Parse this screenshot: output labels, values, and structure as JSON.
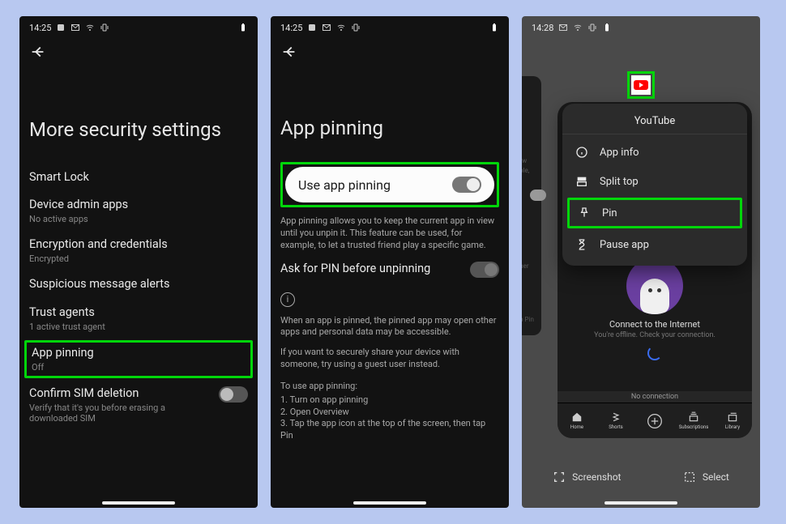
{
  "statusbar": {
    "time1": "14:25",
    "time3": "14:28"
  },
  "screen1": {
    "title": "More security settings",
    "items": [
      {
        "title": "Smart Lock",
        "sub": ""
      },
      {
        "title": "Device admin apps",
        "sub": "No active apps"
      },
      {
        "title": "Encryption and credentials",
        "sub": "Encrypted"
      },
      {
        "title": "Suspicious message alerts",
        "sub": ""
      },
      {
        "title": "Trust agents",
        "sub": "1 active trust agent"
      },
      {
        "title": "App pinning",
        "sub": "Off"
      },
      {
        "title": "Confirm SIM deletion",
        "sub": "Verify that it's you before erasing a downloaded SIM"
      }
    ]
  },
  "screen2": {
    "title": "App pinning",
    "use_toggle_label": "Use app pinning",
    "para1": "App pinning allows you to keep the current app in view until you unpin it. This feature can be used, for example, to let a trusted friend play a specific game.",
    "ask_pin_label": "Ask for PIN before unpinning",
    "para2": "When an app is pinned, the pinned app may open other apps and personal data may be accessible.",
    "para3": "If you want to securely share your device with someone, try using a guest user instead.",
    "howto_title": "To use app pinning:",
    "howto_1": "1. Turn on app pinning",
    "howto_2": "2. Open Overview",
    "howto_3": "3. Tap the app icon at the top of the screen, then tap Pin"
  },
  "screen3": {
    "menu_title": "YouTube",
    "menu_items": {
      "info": "App info",
      "split": "Split top",
      "pin": "Pin",
      "pause": "Pause app"
    },
    "offline_title": "Connect to the Internet",
    "offline_sub": "You're offline. Check your connection.",
    "no_conn": "No connection",
    "nav": {
      "home": "Home",
      "shorts": "Shorts",
      "subs": "Subscriptions",
      "library": "Library"
    },
    "actions": {
      "screenshot": "Screenshot",
      "select": "Select"
    },
    "behind": {
      "t1": "view",
      "t2": "mple,",
      "t3": "other",
      "t4": "tap Pin"
    }
  }
}
